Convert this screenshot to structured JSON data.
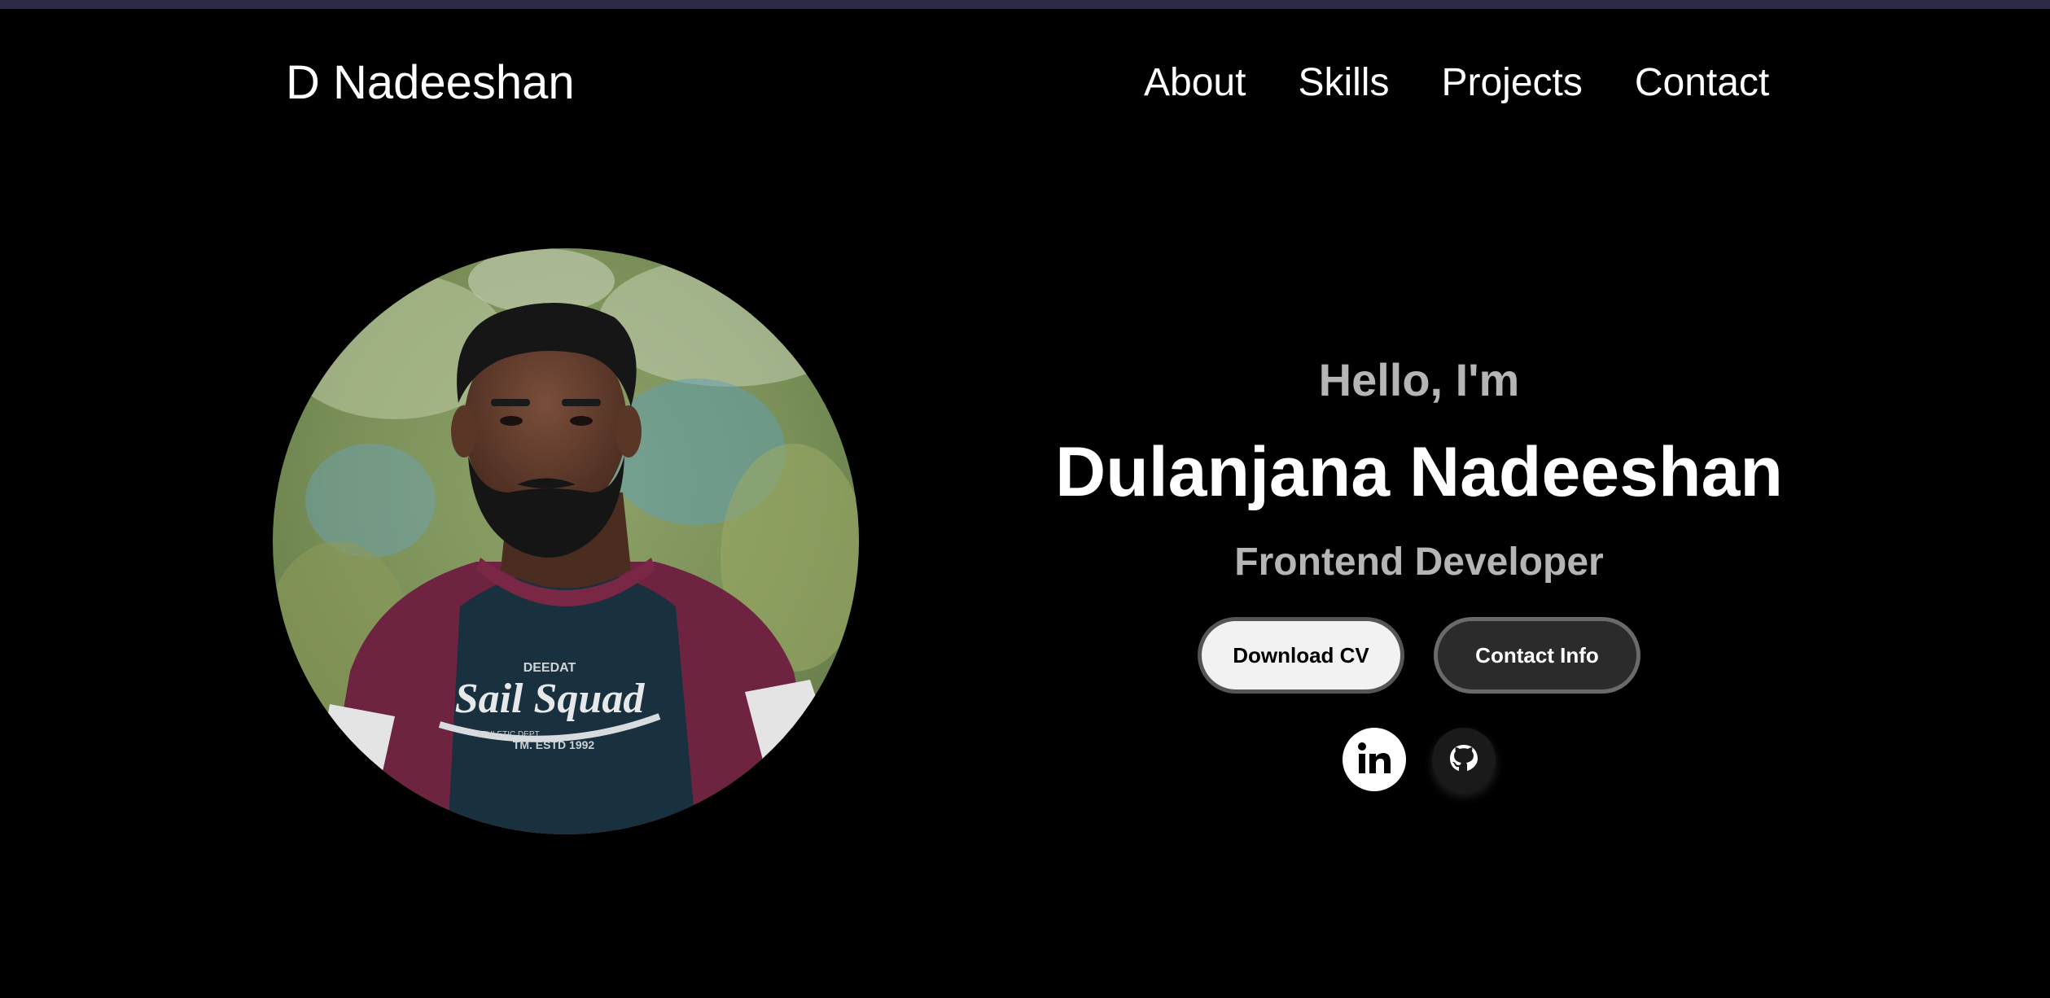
{
  "header": {
    "logo": "D Nadeeshan",
    "nav": [
      "About",
      "Skills",
      "Projects",
      "Contact"
    ]
  },
  "hero": {
    "greeting": "Hello, I'm",
    "name": "Dulanjana Nadeeshan",
    "role": "Frontend Developer",
    "buttons": {
      "download_cv": "Download CV",
      "contact_info": "Contact Info"
    },
    "socials": [
      "linkedin-icon",
      "github-icon"
    ],
    "shirt_text": {
      "top": "DEEDAT",
      "main": "Sail Squad",
      "sub": "ATHLETIC DEPT.",
      "est": "TM. ESTD 1992"
    }
  },
  "colors": {
    "background": "#000000",
    "topbar": "#2b2a44",
    "muted_text": "#b5b5b5",
    "white": "#ffffff"
  }
}
